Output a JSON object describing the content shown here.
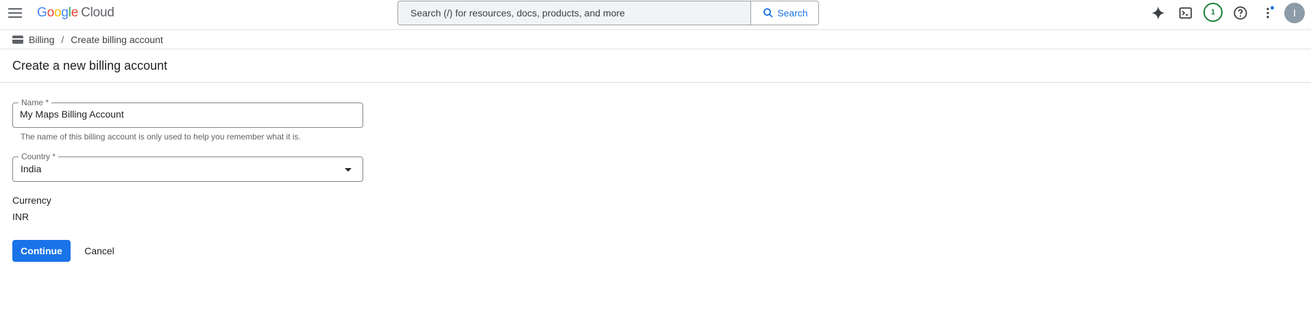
{
  "header": {
    "logo": {
      "brand": "Google",
      "product": "Cloud"
    },
    "search": {
      "placeholder": "Search (/) for resources, docs, products, and more",
      "button_label": "Search"
    },
    "notification_count": "1",
    "avatar_initial": "I",
    "icons": [
      "menu-icon",
      "gemini-spark-icon",
      "cloud-shell-icon",
      "help-icon",
      "more-vert-icon"
    ]
  },
  "breadcrumb": {
    "items": [
      {
        "label": "Billing"
      },
      {
        "label": "Create billing account"
      }
    ],
    "separator": "/"
  },
  "page": {
    "title": "Create a new billing account"
  },
  "form": {
    "name": {
      "label": "Name *",
      "value": "My Maps Billing Account",
      "hint": "The name of this billing account is only used to help you remember what it is."
    },
    "country": {
      "label": "Country *",
      "value": "India"
    },
    "currency": {
      "label": "Currency",
      "value": "INR"
    }
  },
  "actions": {
    "continue_label": "Continue",
    "cancel_label": "Cancel"
  },
  "colors": {
    "primary": "#1a73e8",
    "badge_green": "#188038",
    "text": "#202124",
    "muted": "#5f6368"
  }
}
